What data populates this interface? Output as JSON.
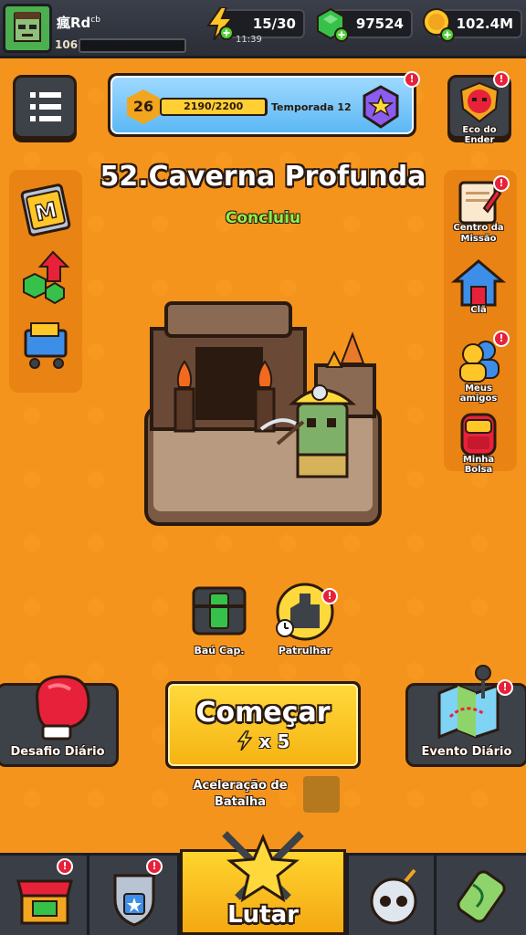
{
  "player": {
    "name": "瘋Rd",
    "name_suffix": "cb",
    "level": "106"
  },
  "resources": {
    "energy": "15/30",
    "energy_timer": "11:39",
    "gems": "97524",
    "coins": "102.4M"
  },
  "season": {
    "level": "26",
    "progress": "2190/2200",
    "progress_fraction": 0.995,
    "label": "Temporada 12"
  },
  "top_right": {
    "label": "Eco do Ender"
  },
  "stage": {
    "title": "52.Caverna Profunda",
    "status": "Concluiu"
  },
  "right_menu": [
    {
      "label": "Centro da Missão"
    },
    {
      "label": "Clã"
    },
    {
      "label": "Meus amigos"
    },
    {
      "label": "Minha Bolsa"
    }
  ],
  "mid": {
    "chest_label": "Baú Cap.",
    "patrol_label": "Patrulhar"
  },
  "actions": {
    "daily_challenge": "Desafio Diário",
    "start_label": "Começar",
    "start_cost": "x 5",
    "daily_event": "Evento Diário",
    "acceleration": "Aceleração de Batalha"
  },
  "nav": {
    "active_label": "Lutar"
  },
  "colors": {
    "background": "#f5941c",
    "accent_yellow": "#ffd93b",
    "badge_red": "#e8213a",
    "status_green": "#8df04a"
  }
}
